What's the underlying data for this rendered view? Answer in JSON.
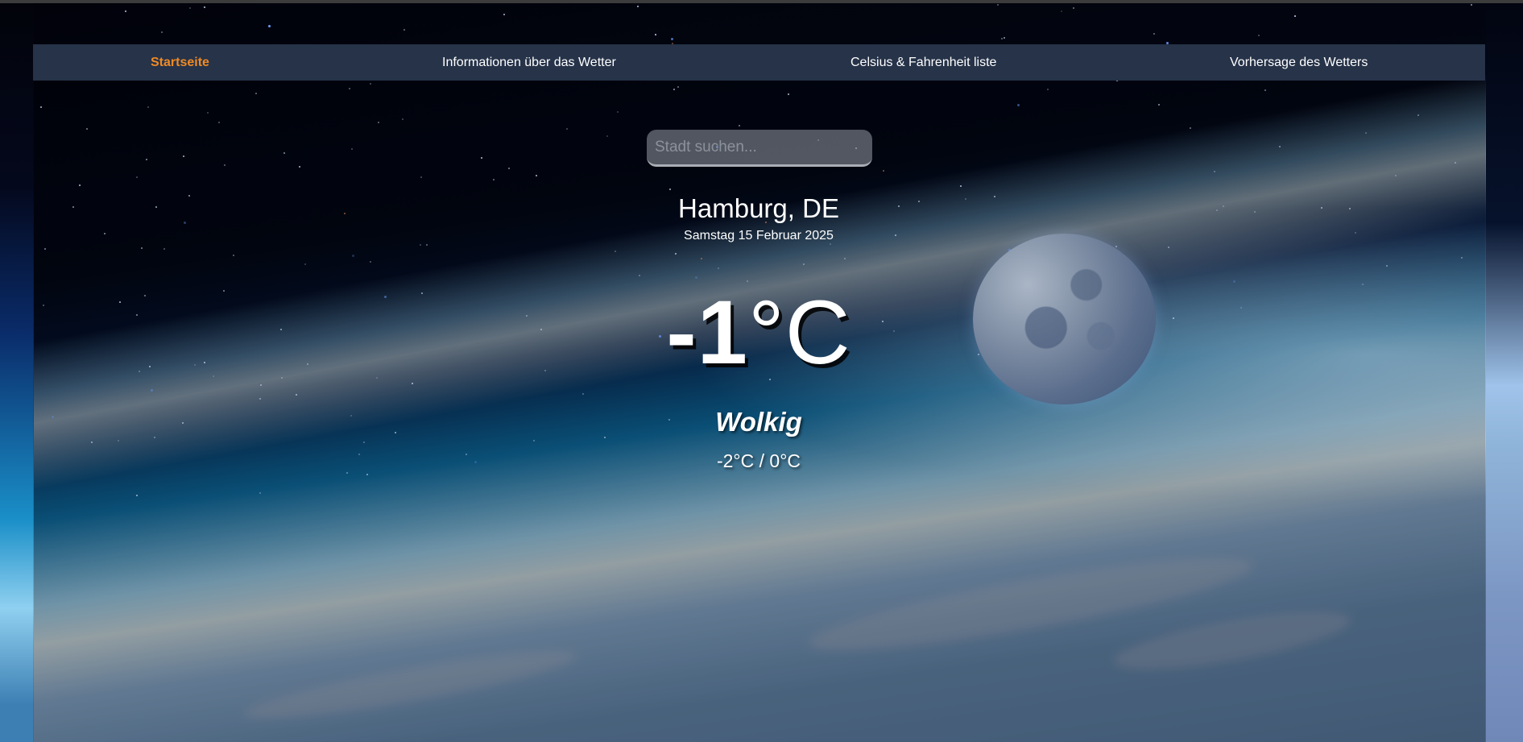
{
  "nav": {
    "items": [
      {
        "label": "Startseite",
        "active": true
      },
      {
        "label": "Informationen über das Wetter",
        "active": false
      },
      {
        "label": "Celsius & Fahrenheit liste",
        "active": false
      },
      {
        "label": "Vorhersage des Wetters",
        "active": false
      }
    ]
  },
  "search": {
    "placeholder": "Stadt suchen...",
    "value": ""
  },
  "weather": {
    "location": "Hamburg, DE",
    "date": "Samstag 15 Februar 2025",
    "temperature": "-1",
    "unit": "°C",
    "condition": "Wolkig",
    "min_max": "-2°C / 0°C"
  },
  "colors": {
    "nav_background": "#263349",
    "nav_active": "#f08a24",
    "text": "#ffffff"
  }
}
